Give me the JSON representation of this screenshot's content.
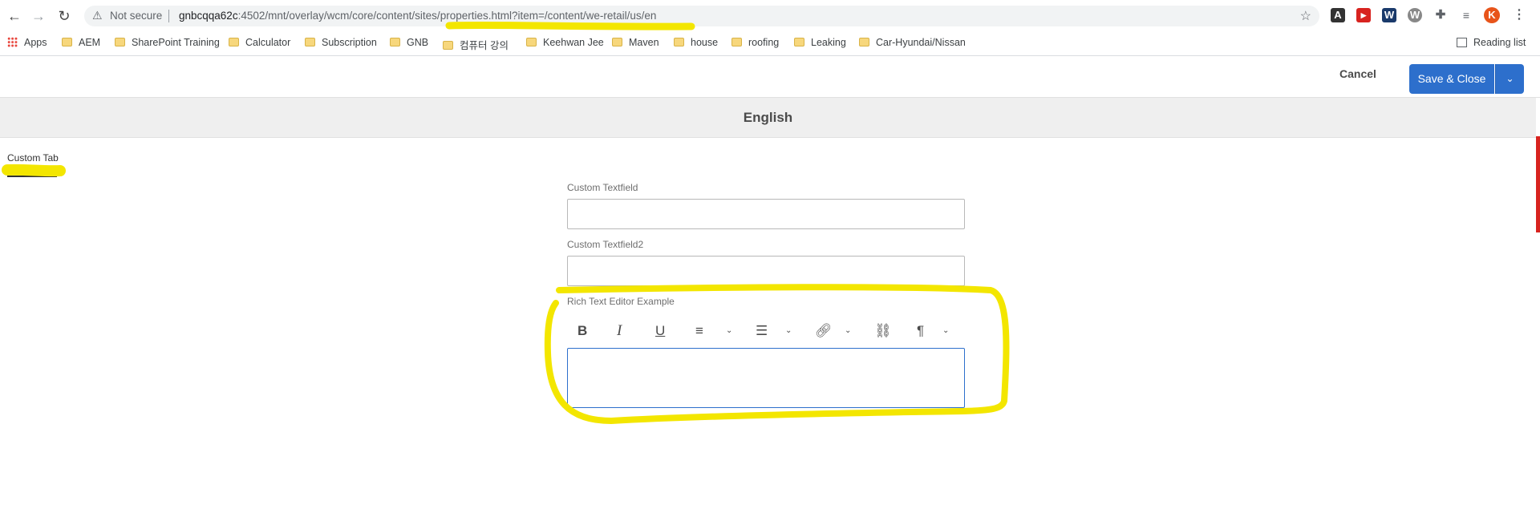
{
  "browser": {
    "security_label": "Not secure",
    "host": "gnbcqqa62c",
    "path": ":4502/mnt/overlay/wcm/core/content/sites/properties.html?item=/content/we-retail/us/en",
    "avatar_letter": "K"
  },
  "bookmarks": {
    "apps_label": "Apps",
    "items": [
      "AEM",
      "SharePoint Training",
      "Calculator",
      "Subscription",
      "GNB",
      "컴퓨터 강의",
      "Keehwan Jee",
      "Maven",
      "house",
      "roofing",
      "Leaking",
      "Car-Hyundai/Nissan"
    ],
    "reading_list": "Reading list"
  },
  "header": {
    "cancel_label": "Cancel",
    "save_close_label": "Save & Close"
  },
  "page": {
    "title": "English"
  },
  "tabs": {
    "active_label": "Custom Tab"
  },
  "form": {
    "field1_label": "Custom Textfield",
    "field1_value": "",
    "field2_label": "Custom Textfield2",
    "field2_value": "",
    "rte_label": "Rich Text Editor Example"
  },
  "rte_toolbar": {
    "icons": [
      "bold-icon",
      "italic-icon",
      "underline-icon",
      "justify-icon",
      "list-icon",
      "link-icon",
      "unlink-icon",
      "paragraph-icon"
    ]
  },
  "colors": {
    "accent": "#2d6fcc",
    "highlight": "#f3e600"
  }
}
